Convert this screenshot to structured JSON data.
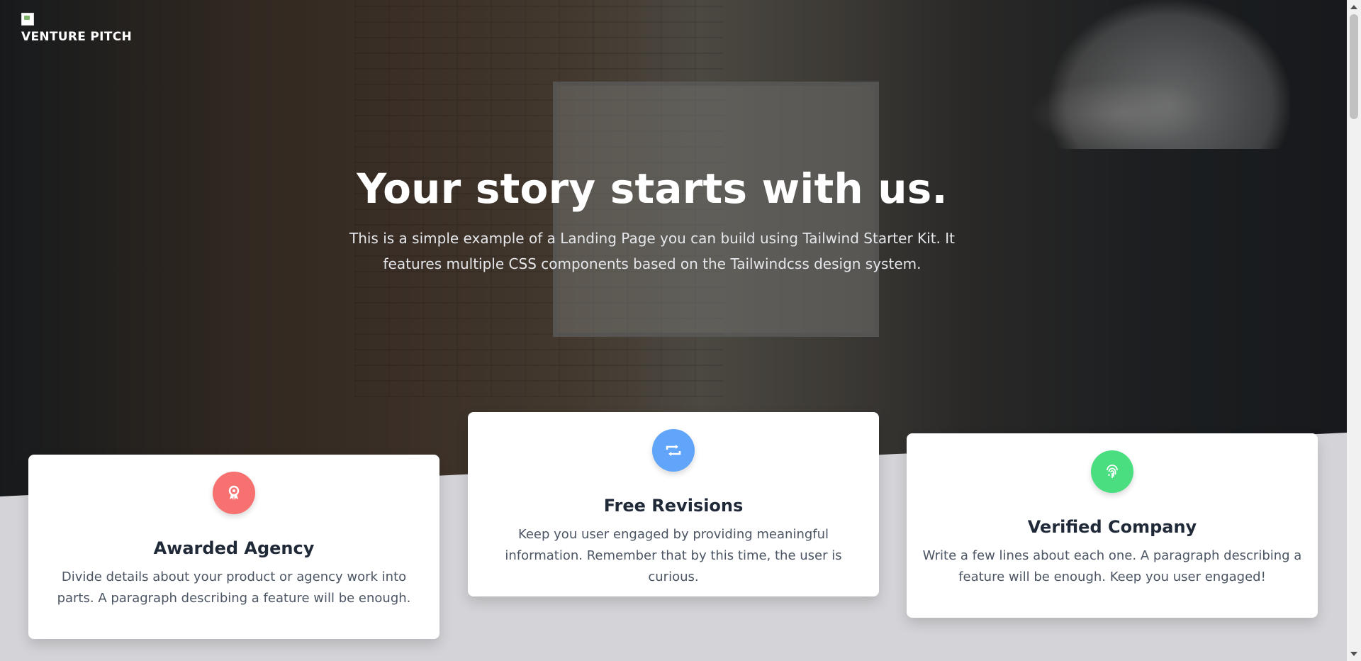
{
  "brand": {
    "logo_icon": "broken-image-icon",
    "name": "VENTURE PITCH"
  },
  "hero": {
    "headline": "Your story starts with us.",
    "subtext": "This is a simple example of a Landing Page you can build using Tailwind Starter Kit. It features multiple CSS components based on the Tailwindcss design system."
  },
  "features": [
    {
      "icon": "award-icon",
      "icon_glyph": "🏅",
      "color": "#f87171",
      "title": "Awarded Agency",
      "text": "Divide details about your product or agency work into parts. A paragraph describing a feature will be enough."
    },
    {
      "icon": "retweet-icon",
      "icon_glyph": "⇄",
      "color": "#60a5fa",
      "title": "Free Revisions",
      "text": "Keep you user engaged by providing meaningful information. Remember that by this time, the user is curious."
    },
    {
      "icon": "fingerprint-icon",
      "icon_glyph": "◉",
      "color": "#4ade80",
      "title": "Verified Company",
      "text": "Write a few lines about each one. A paragraph describing a feature will be enough. Keep you user engaged!"
    }
  ]
}
